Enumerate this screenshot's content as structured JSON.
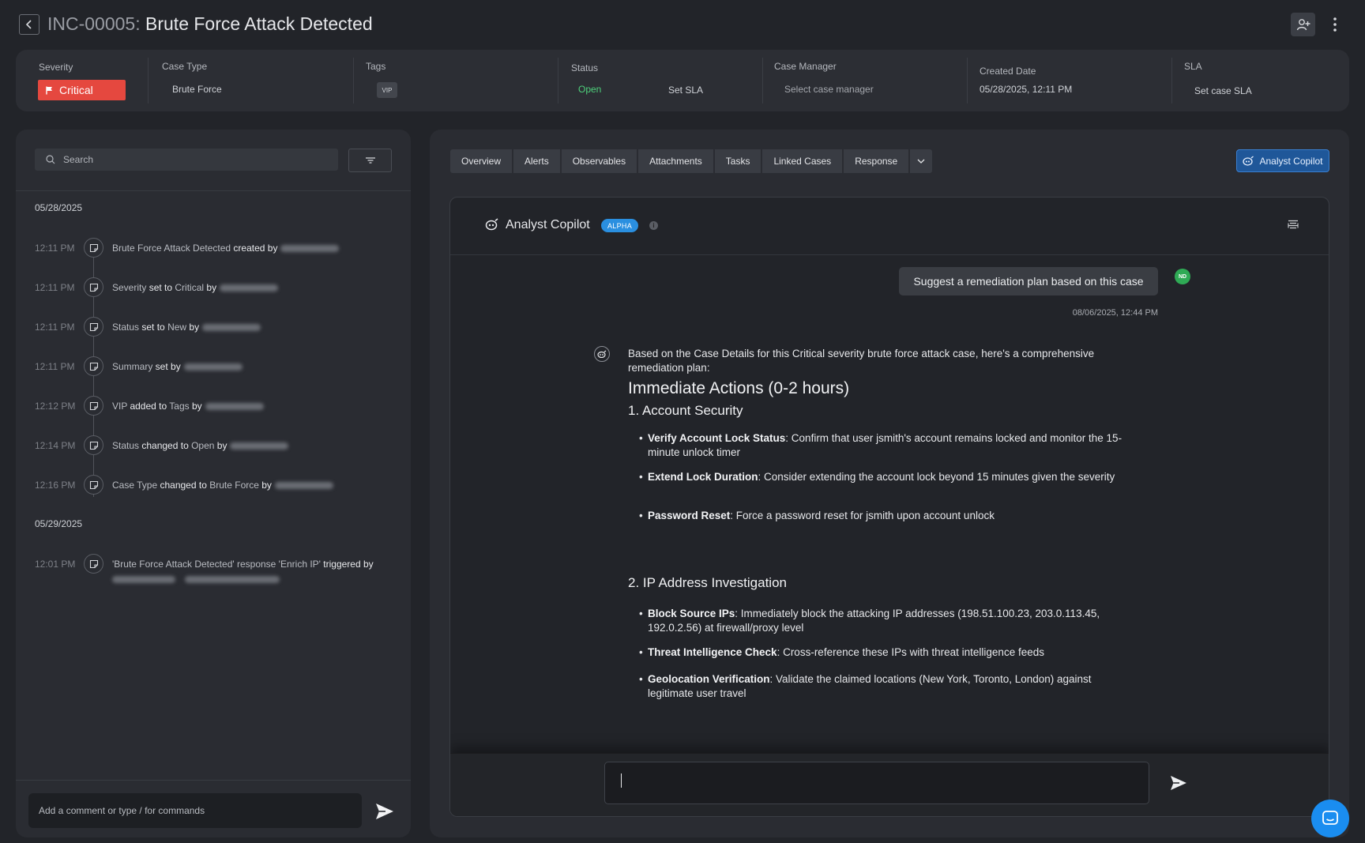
{
  "header": {
    "incident_id": "INC-00005:",
    "title": "Brute Force Attack Detected"
  },
  "info": {
    "severity_label": "Severity",
    "severity_value": "Critical",
    "case_type_label": "Case Type",
    "case_type_value": "Brute Force",
    "tags_label": "Tags",
    "tag_vip": "VIP",
    "status_label": "Status",
    "status_value": "Open",
    "set_sla": "Set SLA",
    "case_manager_label": "Case Manager",
    "case_manager_placeholder": "Select case manager",
    "created_date_label": "Created Date",
    "created_date_value": "05/28/2025, 12:11 PM",
    "sla_label": "SLA",
    "sla_value": "Set case SLA"
  },
  "timeline": {
    "search_placeholder": "Search",
    "dates": [
      "05/28/2025",
      "05/29/2025"
    ],
    "events": [
      {
        "time": "12:11 PM",
        "a": "Brute Force Attack Detected",
        "b": " created by",
        "c": ""
      },
      {
        "time": "12:11 PM",
        "a": "Severity",
        "b": " set to ",
        "c": "Critical",
        "d": " by"
      },
      {
        "time": "12:11 PM",
        "a": "Status",
        "b": " set to ",
        "c": "New",
        "d": " by"
      },
      {
        "time": "12:11 PM",
        "a": "Summary",
        "b": " set by",
        "c": ""
      },
      {
        "time": "12:12 PM",
        "a": "VIP",
        "b": " added to ",
        "c": "Tags",
        "d": " by"
      },
      {
        "time": "12:14 PM",
        "a": "Status",
        "b": " changed to ",
        "c": "Open",
        "d": " by"
      },
      {
        "time": "12:16 PM",
        "a": "Case Type",
        "b": " changed to ",
        "c": "Brute Force",
        "d": " by"
      },
      {
        "time": "12:01 PM",
        "a": "'Brute Force Attack Detected' response 'Enrich IP'",
        "b": " triggered by",
        "c": ""
      }
    ],
    "comment_placeholder": "Add a comment or type / for commands"
  },
  "tabs": [
    "Overview",
    "Alerts",
    "Observables",
    "Attachments",
    "Tasks",
    "Linked Cases",
    "Response"
  ],
  "copilot_button": "Analyst Copilot",
  "copilot": {
    "title": "Analyst Copilot",
    "badge": "ALPHA",
    "user_initials": "ND",
    "user_message": "Suggest a remediation plan based on this case",
    "message_time": "08/06/2025, 12:44 PM",
    "intro": "Based on the Case Details for this Critical severity brute force attack case, here's a comprehensive remediation plan:",
    "h_immediate": "Immediate Actions (0-2 hours)",
    "h_account": "1. Account Security",
    "b1_title": "Verify Account Lock Status",
    "b1_text": ": Confirm that user jsmith's account remains locked and monitor the 15-minute unlock timer",
    "b2_title": "Extend Lock Duration",
    "b2_text": ": Consider extending the account lock beyond 15 minutes given the severity",
    "b3_title": "Password Reset",
    "b3_text": ": Force a password reset for jsmith upon account unlock",
    "h_ip": "2. IP Address Investigation",
    "b4_title": "Block Source IPs",
    "b4_text": ": Immediately block the attacking IP addresses (198.51.100.23, 203.0.113.45, 192.0.2.56) at firewall/proxy level",
    "b5_title": "Threat Intelligence Check",
    "b5_text": ": Cross-reference these IPs with threat intelligence feeds",
    "b6_title": "Geolocation Verification",
    "b6_text": ": Validate the claimed locations (New York, Toronto, London) against legitimate user travel"
  },
  "colors": {
    "critical": "#e5483f",
    "open": "#4ed17b",
    "accent": "#1a8df0"
  }
}
